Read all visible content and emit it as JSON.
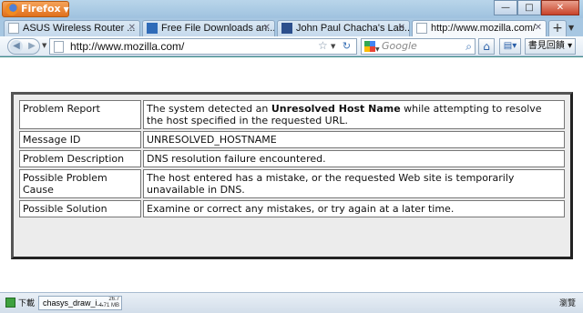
{
  "window": {
    "app_button": "Firefox",
    "minimize": "—",
    "maximize": "□",
    "close": "✕"
  },
  "tabs": [
    {
      "label": "ASUS Wireless Router ...",
      "icon": "page-icon"
    },
    {
      "label": "Free File Downloads an...",
      "icon": "ff-downloads-icon"
    },
    {
      "label": "John Paul Chacha's Lab...",
      "icon": "lab-icon"
    },
    {
      "label": "http://www.mozilla.com/",
      "icon": "page-icon",
      "active": true
    }
  ],
  "navbar": {
    "url": "http://www.mozilla.com/",
    "search_placeholder": "Google",
    "tools_label": "書見回饋 ▾"
  },
  "error_table": {
    "rows": [
      {
        "label": "Problem Report",
        "value_pre": "The system detected an ",
        "value_bold": "Unresolved Host Name",
        "value_post": " while attempting to resolve the host specified in the requested URL."
      },
      {
        "label": "Message ID",
        "value": "UNRESOLVED_HOSTNAME"
      },
      {
        "label": "Problem Description",
        "value": "DNS resolution failure encountered."
      },
      {
        "label": "Possible Problem Cause",
        "value": "The host entered has a mistake, or the requested Web site is temporarily unavailable in DNS."
      },
      {
        "label": "Possible Solution",
        "value": "Examine or correct any mistakes, or try again at a later time."
      }
    ]
  },
  "statusbar": {
    "downloads_label": "下載",
    "download_file": "chasys_draw_i...",
    "download_meta_1": "26.7",
    "download_meta_2": "4.71 MB",
    "right_label": "瀏覽"
  },
  "colors": {
    "titlebar": "#a9cbe6",
    "firefox_button": "#e0701c",
    "content_bg": "#ffffff",
    "table_border": "#555555"
  }
}
